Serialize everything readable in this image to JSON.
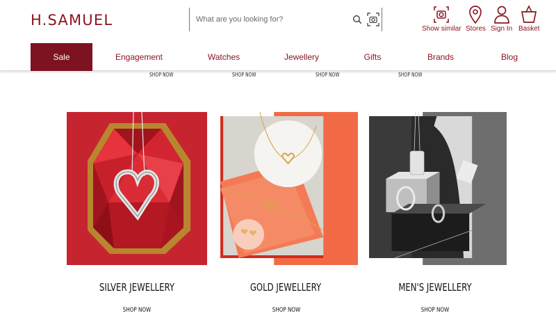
{
  "brand": {
    "logo_text": "H.SAMUEL",
    "color": "#8a1522"
  },
  "search": {
    "placeholder": "What are you looking for?"
  },
  "utility": [
    {
      "label": "Show similar",
      "icon": "camera-search-icon"
    },
    {
      "label": "Stores",
      "icon": "map-pin-icon"
    },
    {
      "label": "Sign In",
      "icon": "user-icon"
    },
    {
      "label": "Basket",
      "icon": "basket-icon"
    }
  ],
  "nav": [
    "Sale",
    "Engagement",
    "Watches",
    "Jewellery",
    "Gifts",
    "Brands",
    "Blog"
  ],
  "previous_row": {
    "shop_now": [
      "SHOP NOW",
      "SHOP NOW",
      "SHOP NOW",
      "SHOP NOW"
    ]
  },
  "categories": [
    {
      "title": "SILVER JEWELLERY",
      "cta": "SHOP NOW"
    },
    {
      "title": "GOLD JEWELLERY",
      "cta": "SHOP NOW"
    },
    {
      "title": "MEN'S JEWELLERY",
      "cta": "SHOP NOW"
    }
  ]
}
